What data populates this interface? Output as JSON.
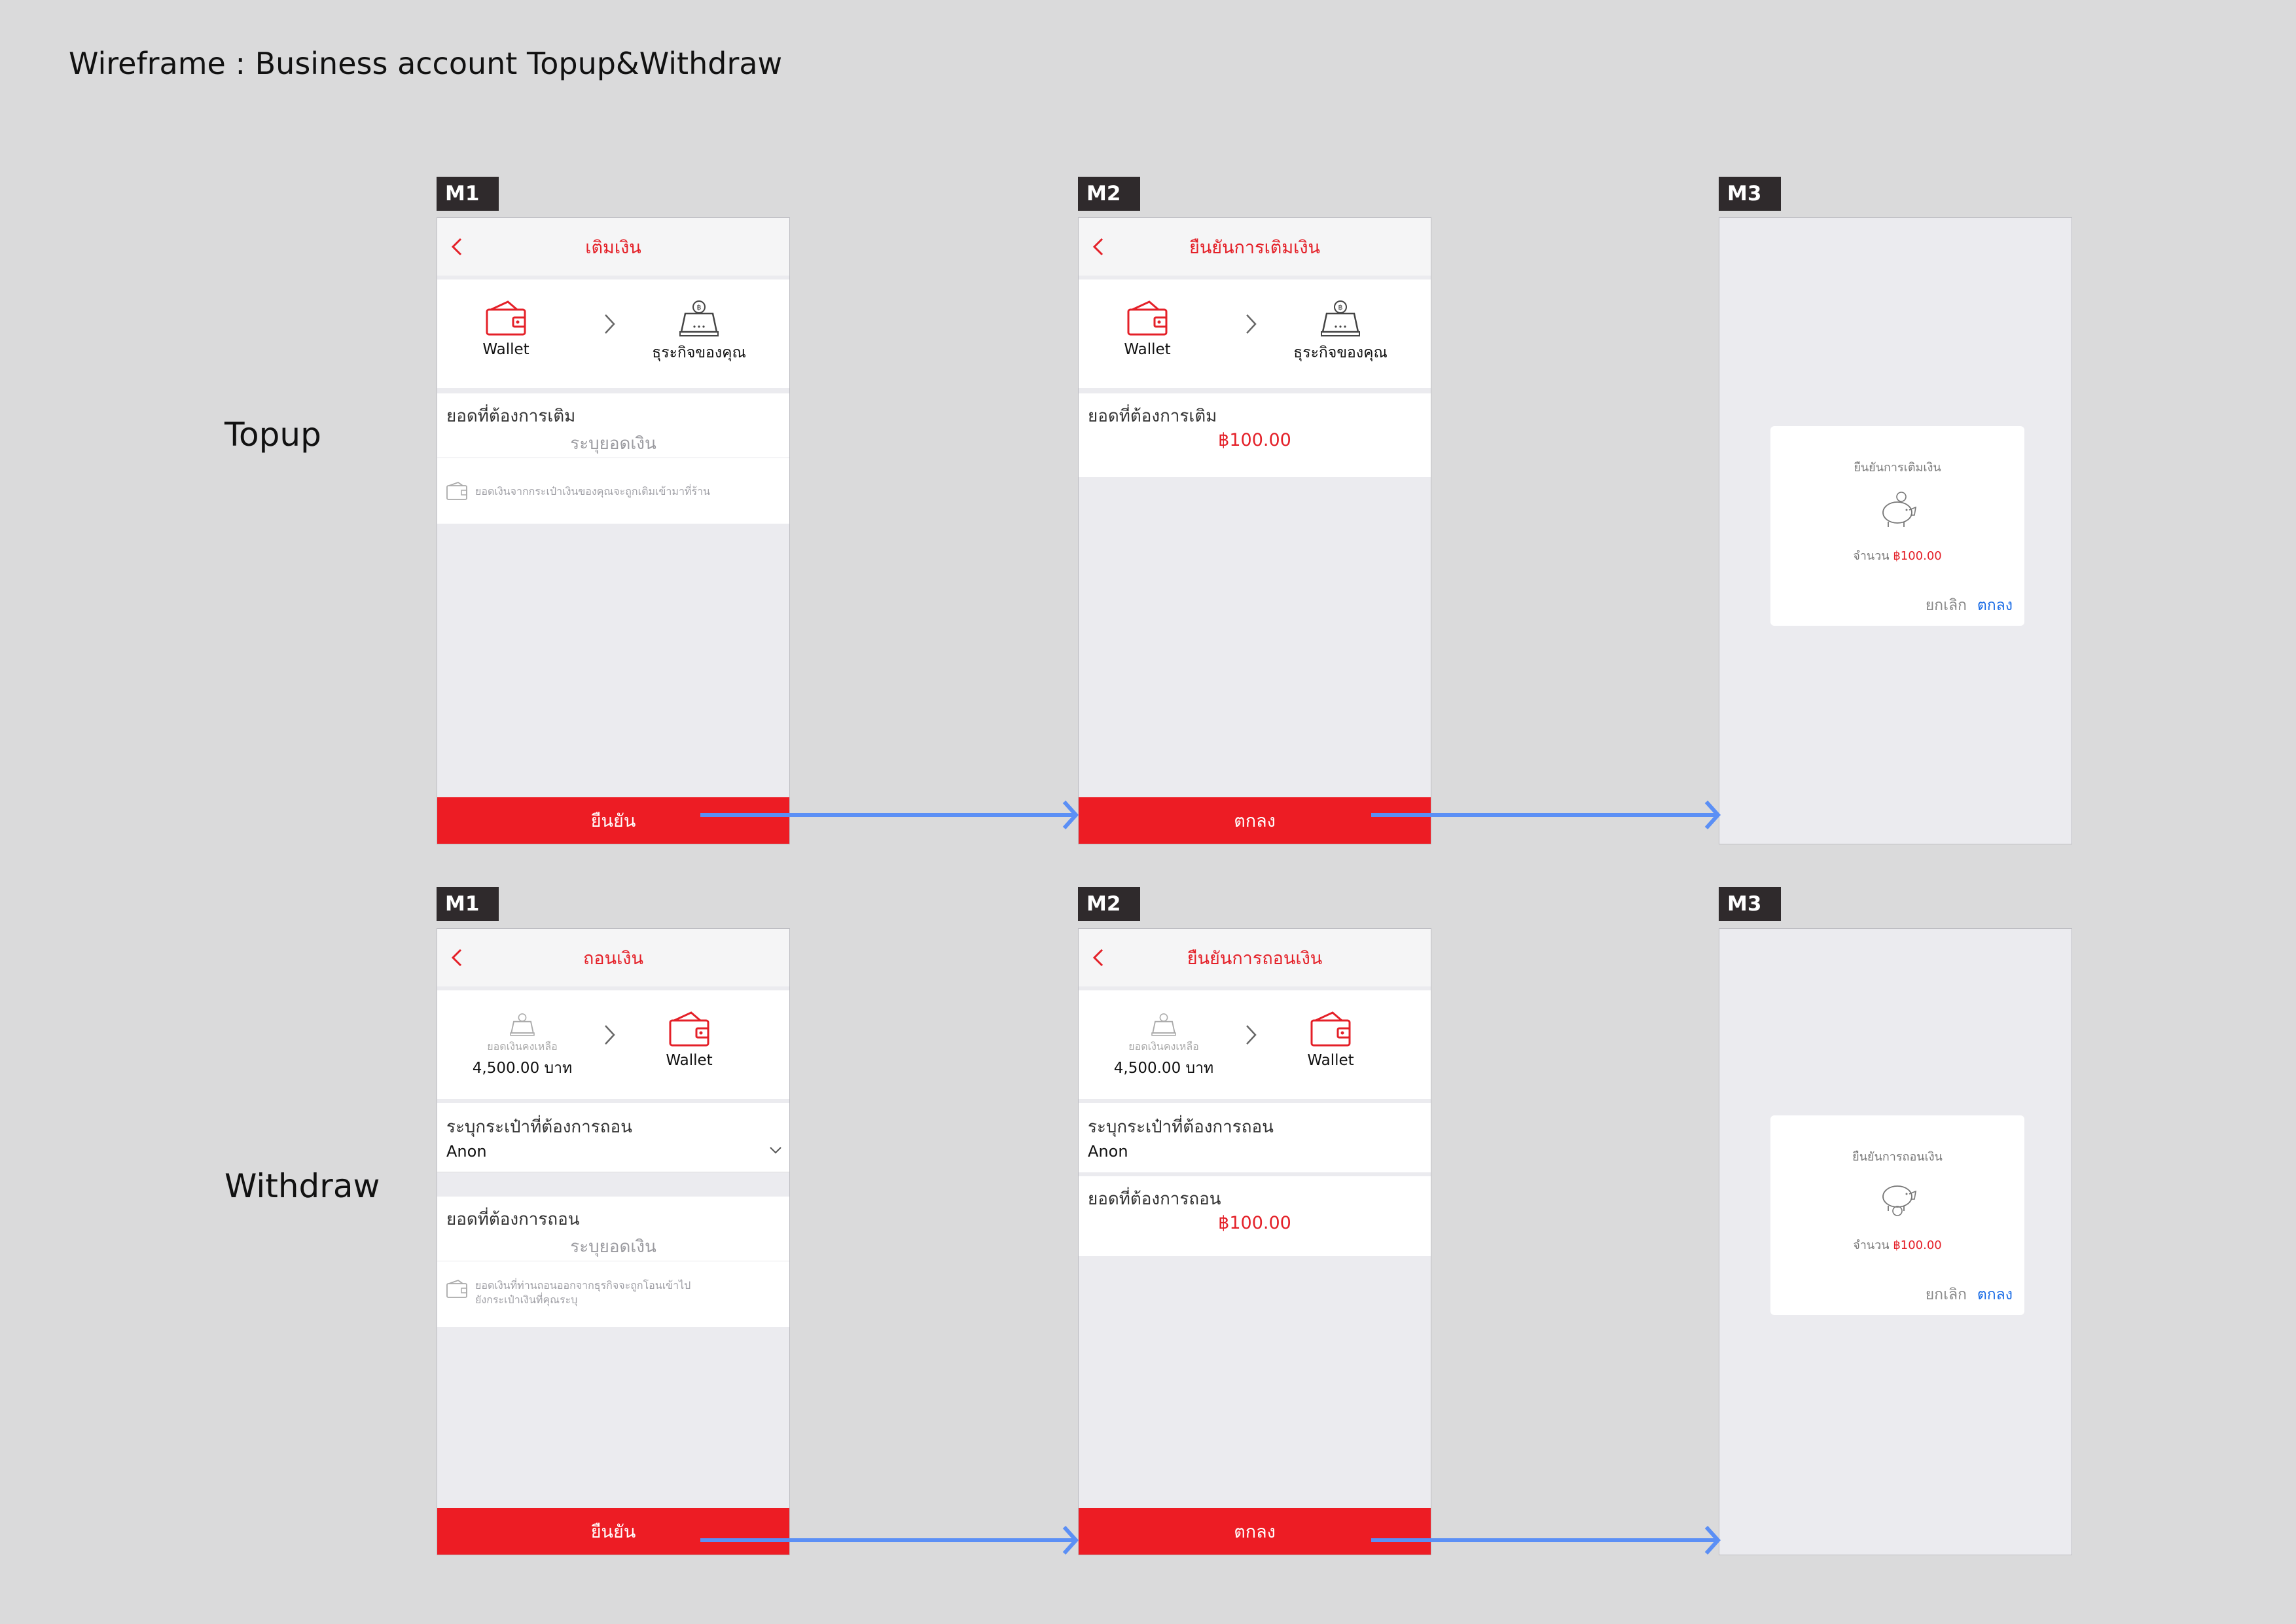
{
  "page_title": "Wireframe : Business account Topup&Withdraw",
  "rows": {
    "topup_label": "Topup",
    "withdraw_label": "Withdraw"
  },
  "colors": {
    "accent_red": "#ed1c24",
    "flow_arrow_blue": "#5b8ff5",
    "ok_blue": "#1d6ee6"
  },
  "topup": {
    "m1": {
      "tag": "M1",
      "title": "เติมเงิน",
      "from_label": "Wallet",
      "to_label": "ธุระกิจของคุณ",
      "amount_label": "ยอดที่ต้องการเติม",
      "amount_placeholder": "ระบุยอดเงิน",
      "note": "ยอดเงินจากกระเป๋าเงินของคุณจะถูกเติมเข้ามาที่ร้าน",
      "button": "ยืนยัน"
    },
    "m2": {
      "tag": "M2",
      "title": "ยืนยันการเติมเงิน",
      "from_label": "Wallet",
      "to_label": "ธุระกิจของคุณ",
      "amount_label": "ยอดที่ต้องการเติม",
      "amount_value": "฿100.00",
      "button": "ตกลง"
    },
    "m3": {
      "tag": "M3",
      "dialog_title": "ยืนยันการเติมเงิน",
      "dialog_amount_label": "จำนวน",
      "dialog_amount_value": "฿100.00",
      "cancel": "ยกเลิก",
      "ok": "ตกลง"
    }
  },
  "withdraw": {
    "m1": {
      "tag": "M1",
      "title": "ถอนเงิน",
      "balance_caption": "ยอดเงินคงเหลือ",
      "balance_value": "4,500.00 บาท",
      "to_label": "Wallet",
      "wallet_label": "ระบุกระเป๋าที่ต้องการถอน",
      "wallet_value": "Anon",
      "amount_label": "ยอดที่ต้องการถอน",
      "amount_placeholder": "ระบุยอดเงิน",
      "note_line1": "ยอดเงินที่ท่านถอนออกจากธุรกิจจะถูกโอนเข้าไป",
      "note_line2": "ยังกระเป๋าเงินที่คุณระบุ",
      "button": "ยืนยัน"
    },
    "m2": {
      "tag": "M2",
      "title": "ยืนยันการถอนเงิน",
      "balance_caption": "ยอดเงินคงเหลือ",
      "balance_value": "4,500.00 บาท",
      "to_label": "Wallet",
      "wallet_label": "ระบุกระเป๋าที่ต้องการถอน",
      "wallet_value": "Anon",
      "amount_label": "ยอดที่ต้องการถอน",
      "amount_value": "฿100.00",
      "button": "ตกลง"
    },
    "m3": {
      "tag": "M3",
      "dialog_title": "ยืนยันการถอนเงิน",
      "dialog_amount_label": "จำนวน",
      "dialog_amount_value": "฿100.00",
      "cancel": "ยกเลิก",
      "ok": "ตกลง"
    }
  }
}
